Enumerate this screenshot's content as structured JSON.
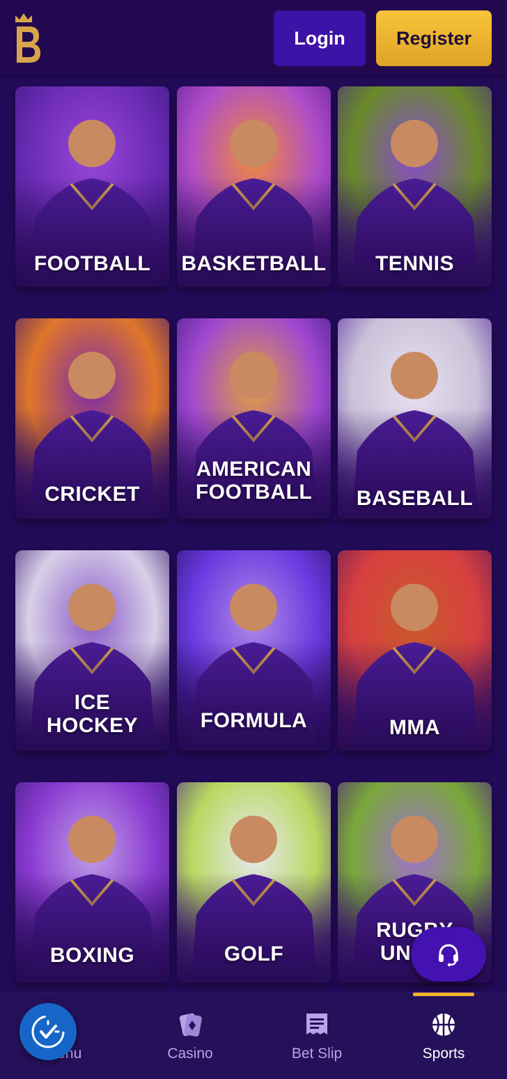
{
  "header": {
    "logo_letter": "B",
    "login_label": "Login",
    "register_label": "Register"
  },
  "sports": [
    {
      "label": "FOOTBALL",
      "scene": "football-players"
    },
    {
      "label": "BASKETBALL",
      "scene": "basketball-player"
    },
    {
      "label": "TENNIS",
      "scene": "tennis-players"
    },
    {
      "label": "CRICKET",
      "scene": "cricket-batsman"
    },
    {
      "label": "AMERICAN\nFOOTBALL",
      "scene": "american-football-player"
    },
    {
      "label": "BASEBALL",
      "scene": "baseball-player"
    },
    {
      "label": "ICE\nHOCKEY",
      "scene": "ice-hockey-player"
    },
    {
      "label": "FORMULA",
      "scene": "formula-driver"
    },
    {
      "label": "MMA",
      "scene": "mma-fighter"
    },
    {
      "label": "BOXING",
      "scene": "boxer"
    },
    {
      "label": "GOLF",
      "scene": "golfer"
    },
    {
      "label": "RUGBY\nUNION",
      "scene": "rugby-player"
    }
  ],
  "bottom_nav": [
    {
      "label": "Menu",
      "icon": "menu-icon",
      "active": false
    },
    {
      "label": "Casino",
      "icon": "casino-cards-icon",
      "active": false
    },
    {
      "label": "Bet Slip",
      "icon": "bet-slip-icon",
      "active": false
    },
    {
      "label": "Sports",
      "icon": "sports-ball-icon",
      "active": true
    }
  ],
  "support_icon": "headset-icon",
  "widget_icon": "accessibility-check-icon",
  "colors": {
    "background": "#220b57",
    "login_button": "#3d12a6",
    "register_button": "#f1b62c",
    "active_indicator": "#f1b62c"
  }
}
